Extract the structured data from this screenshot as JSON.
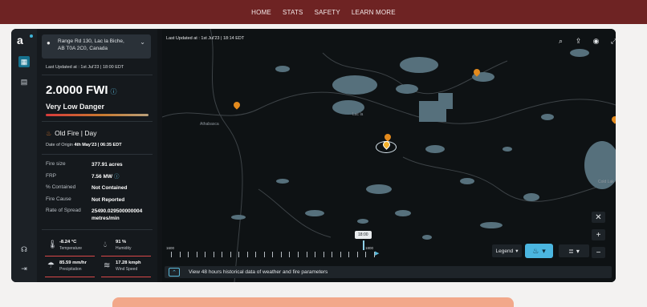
{
  "nav": {
    "items": [
      "HOME",
      "STATS",
      "SAFETY",
      "LEARN MORE"
    ]
  },
  "panel": {
    "location_line1": "Range Rd 130, Lac la Biche,",
    "location_line2": "AB T0A 2C0, Canada",
    "last_updated": "Last Updated at : 1st Jul'23 | 18:00 EDT",
    "fwi_value": "2.0000 FWI",
    "danger": "Very Low Danger",
    "fire_title": "Old Fire | Day",
    "origin_label": "Date of Origin",
    "origin_value": "4th May'23 | 06:35 EDT",
    "stats": [
      {
        "k": "Fire size",
        "v": "377.91 acres"
      },
      {
        "k": "FRP",
        "v": "7.56 MW"
      },
      {
        "k": "% Contained",
        "v": "Not Contained"
      },
      {
        "k": "Fire Cause",
        "v": "Not Reported"
      },
      {
        "k": "Rate of Spread",
        "v": "25490.029500000004 metres/min"
      }
    ],
    "weather": [
      {
        "value": "-8.24 °C",
        "label": "Temperature",
        "icon": "thermometer-icon"
      },
      {
        "value": "91 %",
        "label": "Humidity",
        "icon": "humidity-icon"
      },
      {
        "value": "85.59 mm/hr",
        "label": "Precipitation",
        "icon": "precipitation-icon"
      },
      {
        "value": "17.28 kmph",
        "label": "Wind Speed",
        "icon": "wind-icon"
      }
    ]
  },
  "map": {
    "last_updated": "Last Updated at : 1st Jul'23 | 18:14 EDT",
    "place_athabasca": "Athabasca",
    "place_lacla": "Lac la",
    "place_cold": "Cold Lak",
    "timeline_start": "1600",
    "timeline_end": "1800",
    "timeline_badge": "18:00",
    "legend_label": "Legend",
    "bottom_text": "View 48 hours historical data of weather and fire parameters"
  },
  "colors": {
    "nav_bg": "#6e2323",
    "accent": "#4bb6e0",
    "fire": "#e38a1d",
    "cta": "#f2a88a"
  }
}
